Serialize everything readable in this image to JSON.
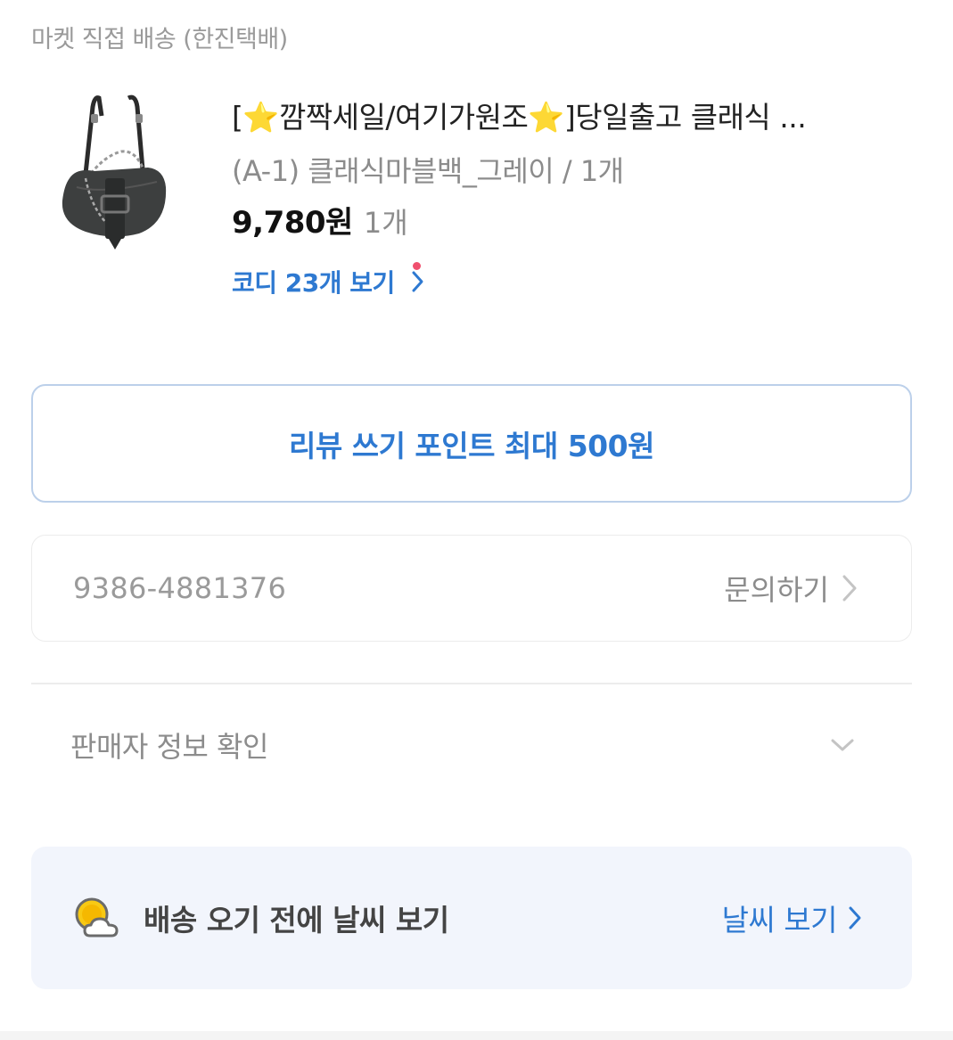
{
  "shipping": {
    "label": "마켓 직접 배송 (한진택배)"
  },
  "product": {
    "title": "[⭐깜짝세일/여기가원조⭐]당일출고 클래식 ...",
    "option": "(A-1) 클래식마블백_그레이 / 1개",
    "price": "9,780원",
    "quantity": "1개",
    "codi_link": "코디 23개 보기"
  },
  "review": {
    "label": "리뷰 쓰기 포인트 최대 500원"
  },
  "order": {
    "number": "9386-4881376",
    "inquiry_label": "문의하기"
  },
  "seller": {
    "label": "판매자 정보 확인"
  },
  "weather": {
    "text": "배송 오기 전에 날씨 보기",
    "link_label": "날씨 보기"
  },
  "colors": {
    "accent": "#2e79d1",
    "notification_dot": "#f0506e",
    "weather_bg": "#f2f5fc"
  }
}
